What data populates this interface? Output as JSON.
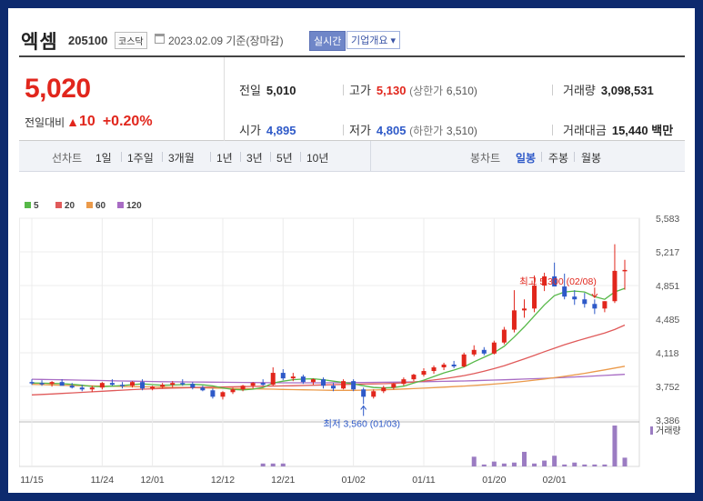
{
  "header": {
    "name": "엑셈",
    "code": "205100",
    "market": "코스닥",
    "date": "2023.02.09 기준(장마감)",
    "realtime_label": "실시간",
    "company_label": "기업개요",
    "company_caret": "▾"
  },
  "summary": {
    "price": "5,020",
    "change_label": "전일대비",
    "change_arrow": "▲",
    "change_value": "10",
    "change_pct": "+0.20%",
    "prev_label": "전일",
    "prev_value": "5,010",
    "open_label": "시가",
    "open_value": "4,895",
    "high_label": "고가",
    "high_value": "5,130",
    "upper_label": "(상한가",
    "upper_value": "6,510)",
    "low_label": "저가",
    "low_value": "4,805",
    "lower_label": "(하한가",
    "lower_value": "3,510)",
    "volume_label": "거래량",
    "volume_value": "3,098,531",
    "amount_label": "거래대금",
    "amount_value": "15,440",
    "amount_unit": "백만"
  },
  "tabs": {
    "line_label": "선차트",
    "periods": [
      "1일",
      "1주일",
      "3개월",
      "1년",
      "3년",
      "5년",
      "10년"
    ],
    "candle_label": "봉차트",
    "candle_types": [
      "일봉",
      "주봉",
      "월봉"
    ],
    "selected_candle": "일봉"
  },
  "colors": {
    "up": "#e1261c",
    "down": "#2e59c8",
    "ma5": "#56b848",
    "ma20": "#e05a5a",
    "ma60": "#eb9a4a",
    "ma120": "#a86cc4",
    "volume": "#9b7cc2"
  },
  "chart_data": {
    "type": "candlestick",
    "legend": [
      "5",
      "20",
      "60",
      "120"
    ],
    "y_ticks": [
      "5,583",
      "5,217",
      "4,851",
      "4,485",
      "4,118",
      "3,752",
      "3,386"
    ],
    "ylim": [
      3386,
      5583
    ],
    "x_ticks": [
      "11/15",
      "11/24",
      "12/01",
      "12/12",
      "12/21",
      "01/02",
      "01/11",
      "01/20",
      "02/01"
    ],
    "x_tick_index": [
      0,
      7,
      12,
      19,
      25,
      32,
      39,
      46,
      52
    ],
    "volume_label": "거래량",
    "high_annotation": "최고 5,300 (02/08)",
    "low_annotation": "최저 3,560 (01/03)",
    "high_index": 56,
    "low_index": 33,
    "candles": [
      [
        3800,
        3830,
        3770,
        3790
      ],
      [
        3790,
        3820,
        3760,
        3780
      ],
      [
        3780,
        3810,
        3750,
        3800
      ],
      [
        3800,
        3830,
        3770,
        3760
      ],
      [
        3760,
        3790,
        3730,
        3740
      ],
      [
        3740,
        3770,
        3700,
        3720
      ],
      [
        3720,
        3760,
        3690,
        3740
      ],
      [
        3740,
        3800,
        3720,
        3790
      ],
      [
        3790,
        3830,
        3760,
        3770
      ],
      [
        3770,
        3800,
        3730,
        3760
      ],
      [
        3760,
        3810,
        3740,
        3800
      ],
      [
        3800,
        3830,
        3710,
        3730
      ],
      [
        3730,
        3760,
        3710,
        3750
      ],
      [
        3750,
        3790,
        3730,
        3770
      ],
      [
        3770,
        3810,
        3740,
        3790
      ],
      [
        3790,
        3830,
        3760,
        3780
      ],
      [
        3780,
        3800,
        3720,
        3740
      ],
      [
        3740,
        3760,
        3700,
        3710
      ],
      [
        3710,
        3730,
        3620,
        3640
      ],
      [
        3640,
        3700,
        3610,
        3690
      ],
      [
        3690,
        3740,
        3670,
        3720
      ],
      [
        3720,
        3770,
        3700,
        3760
      ],
      [
        3760,
        3800,
        3730,
        3790
      ],
      [
        3790,
        3830,
        3760,
        3770
      ],
      [
        3770,
        3960,
        3760,
        3900
      ],
      [
        3900,
        3940,
        3820,
        3840
      ],
      [
        3840,
        3900,
        3810,
        3860
      ],
      [
        3860,
        3880,
        3780,
        3800
      ],
      [
        3800,
        3840,
        3770,
        3830
      ],
      [
        3830,
        3850,
        3730,
        3760
      ],
      [
        3760,
        3790,
        3700,
        3730
      ],
      [
        3730,
        3830,
        3720,
        3810
      ],
      [
        3810,
        3830,
        3700,
        3720
      ],
      [
        3720,
        3740,
        3560,
        3640
      ],
      [
        3640,
        3720,
        3620,
        3700
      ],
      [
        3700,
        3760,
        3680,
        3740
      ],
      [
        3740,
        3790,
        3720,
        3780
      ],
      [
        3780,
        3850,
        3760,
        3830
      ],
      [
        3830,
        3890,
        3810,
        3880
      ],
      [
        3880,
        3950,
        3860,
        3920
      ],
      [
        3920,
        3980,
        3890,
        3960
      ],
      [
        3960,
        4010,
        3930,
        3990
      ],
      [
        3990,
        4030,
        3950,
        3970
      ],
      [
        3970,
        4120,
        3960,
        4100
      ],
      [
        4100,
        4200,
        4080,
        4150
      ],
      [
        4150,
        4180,
        4090,
        4110
      ],
      [
        4110,
        4250,
        4100,
        4230
      ],
      [
        4230,
        4400,
        4210,
        4370
      ],
      [
        4370,
        4800,
        4340,
        4580
      ],
      [
        4580,
        4700,
        4500,
        4600
      ],
      [
        4600,
        4960,
        4560,
        4850
      ],
      [
        4850,
        4990,
        4790,
        4950
      ],
      [
        4950,
        5100,
        4930,
        4840
      ],
      [
        4840,
        4980,
        4700,
        4730
      ],
      [
        4730,
        4800,
        4640,
        4700
      ],
      [
        4700,
        4770,
        4610,
        4650
      ],
      [
        4650,
        4700,
        4540,
        4600
      ],
      [
        4600,
        4680,
        4560,
        4680
      ],
      [
        4680,
        5300,
        4660,
        5010
      ],
      [
        5010,
        5130,
        4805,
        5020
      ]
    ],
    "volumes": [
      0,
      0,
      0,
      0,
      0,
      0,
      0,
      0,
      0,
      0,
      0,
      0,
      0,
      0,
      0,
      0,
      0,
      0,
      0,
      0,
      0,
      0,
      0,
      3,
      3,
      3,
      0,
      0,
      0,
      0,
      0,
      0,
      0,
      0,
      0,
      0,
      0,
      0,
      0,
      0,
      0,
      0,
      0,
      0,
      10,
      2,
      5,
      3,
      4,
      15,
      3,
      6,
      11,
      2,
      4,
      2,
      2,
      2,
      42,
      9
    ],
    "ma5": [
      3790,
      3788,
      3785,
      3783,
      3775,
      3765,
      3752,
      3750,
      3755,
      3762,
      3772,
      3780,
      3772,
      3765,
      3768,
      3772,
      3775,
      3770,
      3758,
      3735,
      3720,
      3715,
      3722,
      3740,
      3790,
      3810,
      3825,
      3832,
      3835,
      3825,
      3810,
      3795,
      3780,
      3760,
      3740,
      3735,
      3740,
      3755,
      3790,
      3820,
      3860,
      3900,
      3930,
      3965,
      4020,
      4070,
      4120,
      4190,
      4290,
      4400,
      4520,
      4640,
      4740,
      4780,
      4790,
      4780,
      4730,
      4700,
      4780,
      4820
    ],
    "ma20": [
      3660,
      3665,
      3670,
      3676,
      3682,
      3688,
      3694,
      3700,
      3706,
      3712,
      3718,
      3722,
      3726,
      3730,
      3733,
      3736,
      3739,
      3742,
      3744,
      3746,
      3748,
      3750,
      3752,
      3754,
      3756,
      3758,
      3760,
      3763,
      3766,
      3769,
      3772,
      3774,
      3776,
      3778,
      3780,
      3782,
      3786,
      3792,
      3800,
      3810,
      3822,
      3836,
      3852,
      3870,
      3892,
      3918,
      3946,
      3978,
      4014,
      4052,
      4090,
      4130,
      4168,
      4206,
      4240,
      4272,
      4302,
      4334,
      4372,
      4420
    ],
    "ma60": [
      3775,
      3772,
      3769,
      3766,
      3763,
      3760,
      3758,
      3756,
      3754,
      3752,
      3750,
      3748,
      3746,
      3744,
      3742,
      3740,
      3738,
      3736,
      3734,
      3732,
      3730,
      3728,
      3726,
      3724,
      3722,
      3720,
      3718,
      3716,
      3714,
      3712,
      3710,
      3710,
      3710,
      3712,
      3714,
      3717,
      3720,
      3724,
      3728,
      3733,
      3738,
      3744,
      3750,
      3756,
      3763,
      3770,
      3778,
      3787,
      3797,
      3808,
      3820,
      3833,
      3847,
      3862,
      3878,
      3895,
      3913,
      3932,
      3952,
      3972
    ],
    "ma120": [
      3830,
      3828,
      3826,
      3824,
      3822,
      3820,
      3818,
      3816,
      3814,
      3812,
      3810,
      3808,
      3806,
      3804,
      3803,
      3802,
      3801,
      3800,
      3799,
      3798,
      3797,
      3796,
      3795,
      3794,
      3793,
      3792,
      3792,
      3792,
      3792,
      3792,
      3793,
      3794,
      3795,
      3796,
      3797,
      3798,
      3799,
      3800,
      3802,
      3804,
      3806,
      3808,
      3810,
      3812,
      3815,
      3818,
      3821,
      3824,
      3828,
      3832,
      3836,
      3840,
      3845,
      3850,
      3855,
      3860,
      3866,
      3872,
      3878,
      3884
    ]
  }
}
